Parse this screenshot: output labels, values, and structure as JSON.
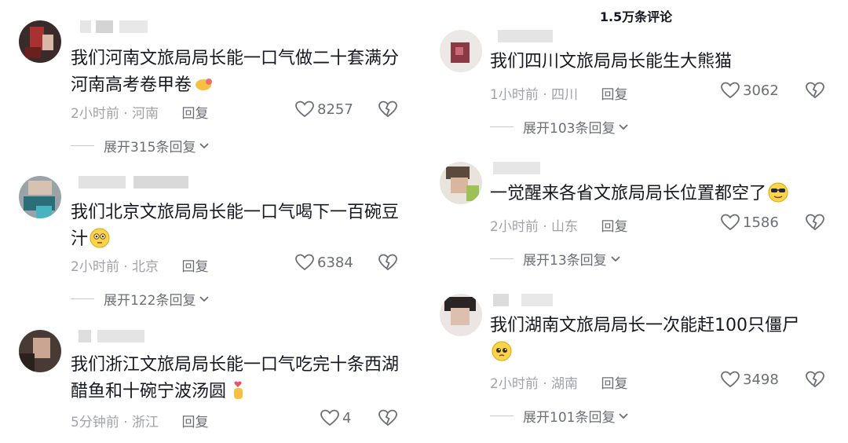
{
  "header": {
    "title": "1.5万条评论"
  },
  "left": [
    {
      "text": "我们河南文旅局局长能一口气做二十套满分河南高考卷甲卷",
      "time": "2小时前",
      "location": "河南",
      "reply": "回复",
      "likes": "8257",
      "expand": "展开315条回复",
      "emoji": "flexed-arm-icon"
    },
    {
      "text": "我们北京文旅局局长能一口气喝下一百碗豆汁",
      "time": "2小时前",
      "location": "北京",
      "reply": "回复",
      "likes": "6384",
      "expand": "展开122条回复",
      "emoji": "flushed-face-icon"
    },
    {
      "text": "我们浙江文旅局局长能一口气吃完十条西湖醋鱼和十碗宁波汤圆",
      "time": "5分钟前",
      "location": "浙江",
      "reply": "回复",
      "likes": "4",
      "emoji": "finger-heart-icon"
    }
  ],
  "right": [
    {
      "text": "我们四川文旅局局长能生大熊猫",
      "time": "1小时前",
      "location": "四川",
      "reply": "回复",
      "likes": "3062",
      "expand": "展开103条回复"
    },
    {
      "text": "一觉醒来各省文旅局局长位置都空了",
      "time": "2小时前",
      "location": "山东",
      "reply": "回复",
      "likes": "1586",
      "expand": "展开13条回复",
      "emoji": "sunglasses-face-icon"
    },
    {
      "text": "我们湖南文旅局局长一次能赶100只僵尸",
      "time": "2小时前",
      "location": "湖南",
      "reply": "回复",
      "likes": "3498",
      "expand": "展开101条回复",
      "emoji": "pleading-face-icon"
    }
  ],
  "colors": {
    "text": "#161823",
    "meta": "#a0a2a8",
    "accent": "#6b6e76"
  }
}
